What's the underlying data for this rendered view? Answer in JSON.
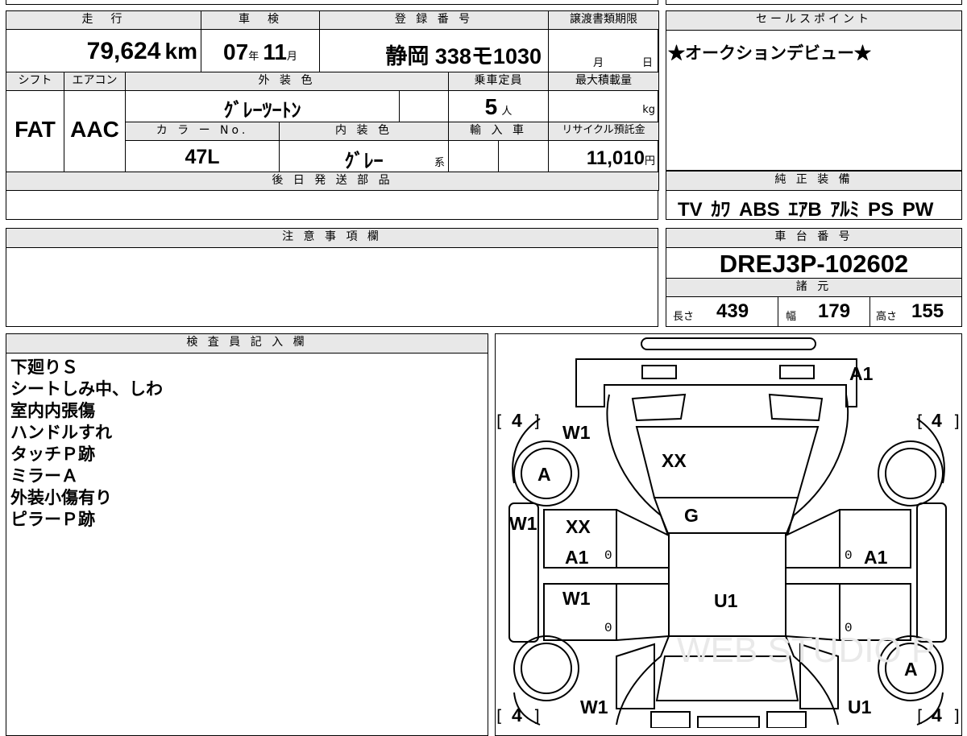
{
  "summary": {
    "mileage_label": "走　行",
    "mileage_value": "79,624",
    "mileage_unit": "km",
    "inspection_label": "車　検",
    "inspection_year": "07",
    "inspection_year_unit": "年",
    "inspection_month": "11",
    "inspection_month_unit": "月",
    "registration_label": "登 録 番 号",
    "registration_value": "静岡 338モ1030",
    "transfer_label": "譲渡書類期限",
    "transfer_month_unit": "月",
    "transfer_day_unit": "日",
    "shift_label": "シフト",
    "shift_value": "FAT",
    "ac_label": "エアコン",
    "ac_value": "AAC",
    "exterior_color_label": "外 装 色",
    "exterior_color_value": "ｸﾞﾚｰﾂｰﾄﾝ",
    "color_no_label": "カ ラ ー No.",
    "color_no_value": "47L",
    "interior_color_label": "内 装 色",
    "interior_color_value": "ｸﾞﾚｰ",
    "interior_color_suffix": "系",
    "capacity_label": "乗車定員",
    "capacity_value": "5",
    "capacity_unit": "人",
    "max_load_label": "最大積載量",
    "max_load_unit": "kg",
    "import_label": "輸 入 車",
    "recycle_label": "リサイクル預託金",
    "recycle_value": "11,010",
    "recycle_unit": "円",
    "later_parts_label": "後 日 発 送 部 品"
  },
  "sales_point": {
    "label": "セールスポイント",
    "text": "★オークションデビュー★"
  },
  "genuine_equipment": {
    "label": "純 正 装 備",
    "items": "TV ｶﾜ ABS ｴｱB ｱﾙﾐ PS PW"
  },
  "notes": {
    "label": "注 意 事 項 欄"
  },
  "chassis": {
    "label": "車 台 番 号",
    "value": "DREJ3P-102602",
    "specs_label": "諸 元",
    "length_label": "長さ",
    "length_value": "439",
    "width_label": "幅",
    "width_value": "179",
    "height_label": "高さ",
    "height_value": "155"
  },
  "inspector": {
    "label": "検 査 員 記 入 欄",
    "lines": [
      "下廻りＳ",
      "シートしみ中、しわ",
      "室内内張傷",
      "ハンドルすれ",
      "タッチＰ跡",
      "ミラーＡ",
      "外装小傷有り",
      "ピラーＰ跡"
    ]
  },
  "diagram": {
    "marks": {
      "rear_bumper": "A1",
      "tire_fl": "4",
      "tire_fr": "4",
      "tire_rl": "4",
      "tire_rr": "4",
      "wheel_fl": "A",
      "wheel_rr": "A",
      "hood_side_left": "W1",
      "hood": "XX",
      "roof": "G",
      "left_fender": "W1",
      "left_front_door_1": "XX",
      "left_front_door_2": "A1",
      "left_rear_door": "W1",
      "right_front_door": "A1",
      "cabin": "U1",
      "rear_left": "W1",
      "rear_right": "U1",
      "zero_l1": "0",
      "zero_l2": "0",
      "zero_r1": "0",
      "zero_r2": "0"
    },
    "watermark": "WEB STUDIO P"
  }
}
